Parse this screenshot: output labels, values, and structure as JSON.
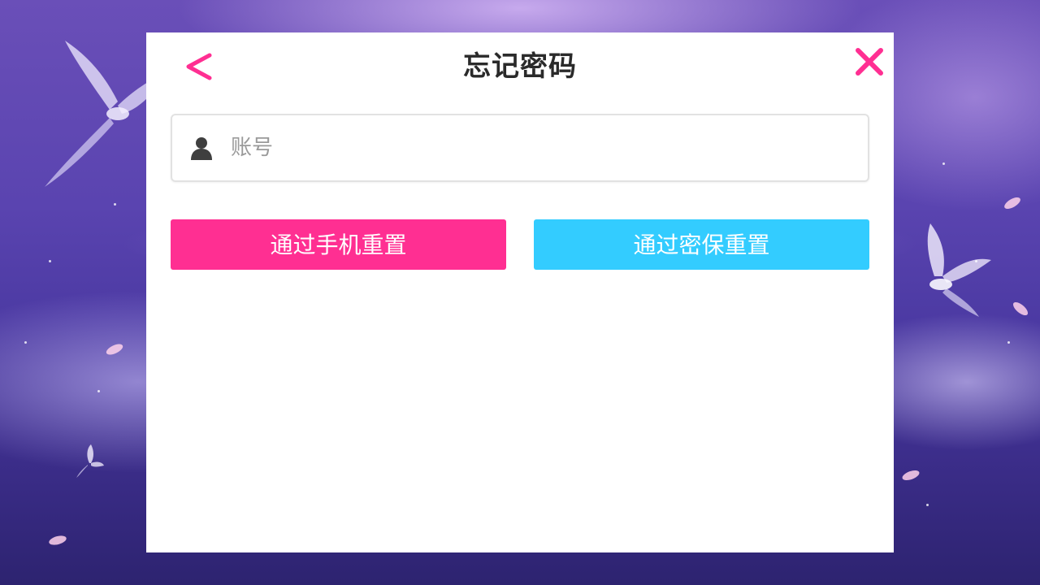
{
  "dialog": {
    "title": "忘记密码",
    "back_icon": "chevron-left-icon",
    "close_icon": "close-icon"
  },
  "account_field": {
    "icon": "user-icon",
    "placeholder": "账号",
    "value": ""
  },
  "buttons": {
    "reset_by_phone": "通过手机重置",
    "reset_by_security": "通过密保重置"
  },
  "colors": {
    "accent_pink": "#ff2f92",
    "accent_cyan": "#33ccff",
    "title_text": "#2a2a2a",
    "placeholder_text": "#9a9a9a",
    "background_purple": "#5a44b0"
  }
}
